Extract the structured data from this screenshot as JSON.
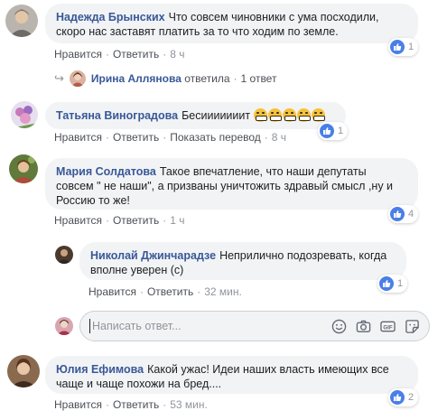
{
  "comments": [
    {
      "author": "Надежда Брынских",
      "text_l1": "Что совсем чиновники с ума посходили,",
      "text_l2": "скоро нас заставят платить за то что ходим по земле.",
      "like_label": "Нравится",
      "reply_label": "Ответить",
      "time": "8 ч",
      "reaction_count": "1",
      "reply_summary": {
        "name": "Ирина Аллянова",
        "action": "ответила",
        "count": "1 ответ"
      }
    },
    {
      "author": "Татьяна Виноградова",
      "text_l1": "Бесииииииит",
      "emoji_count": 5,
      "like_label": "Нравится",
      "reply_label": "Ответить",
      "translate_label": "Показать перевод",
      "time": "8 ч",
      "reaction_count": "1"
    },
    {
      "author": "Мария Солдатова",
      "text_l1": "Такое впечатление, что наши депутаты",
      "text_l2": "совсем \" не наши\", а призваны уничтожить здравый смысл ,ну и",
      "text_l3": "Россию то же!",
      "like_label": "Нравится",
      "reply_label": "Ответить",
      "time": "1 ч",
      "reaction_count": "4"
    },
    {
      "author": "Николай Джинчарадзе",
      "text_l1": "Неприлично подозревать, когда",
      "text_l2": "вполне уверен (с)",
      "like_label": "Нравится",
      "reply_label": "Ответить",
      "time": "32 мин.",
      "reaction_count": "1"
    },
    {
      "author": "Юлия Ефимова",
      "text_l1": "Какой ужас! Идеи наших власть имеющих все",
      "text_l2": "чаще и чаще похожи на бред....",
      "like_label": "Нравится",
      "reply_label": "Ответить",
      "time": "53 мин.",
      "reaction_count": "2"
    }
  ],
  "composer": {
    "placeholder": "Написать ответ..."
  },
  "icons": {
    "emoji": "smiley-icon",
    "camera": "camera-icon",
    "gif": "gif-icon",
    "sticker": "sticker-icon",
    "like": "thumbs-up-icon"
  },
  "colors": {
    "author": "#385898",
    "bubble": "#f2f3f5",
    "like_badge": "#4a7fe8",
    "meta": "#90949c"
  }
}
